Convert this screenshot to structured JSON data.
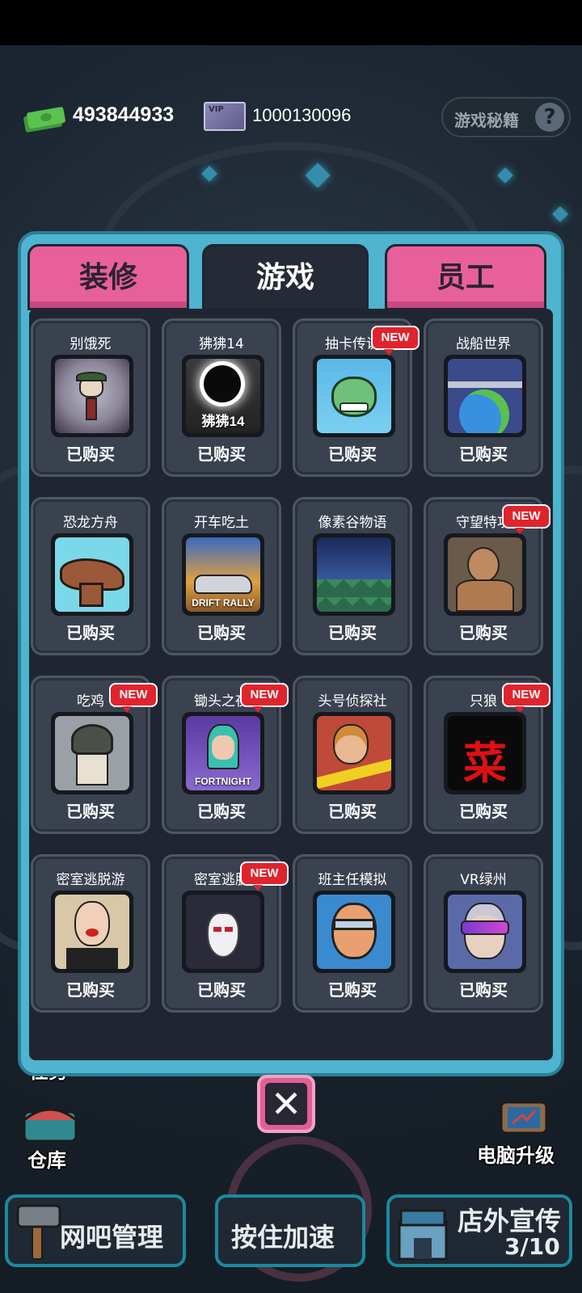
{
  "topbar": {
    "cash": "493844933",
    "vip_badge": "VIP",
    "vip_value": "1000130096",
    "secret_label": "游戏秘籍",
    "help_glyph": "?"
  },
  "tabs": [
    {
      "label": "装修"
    },
    {
      "label": "游戏"
    },
    {
      "label": "员工"
    }
  ],
  "partial_row_status": [
    "已购买",
    "已购买",
    "已购买",
    "已购买"
  ],
  "games": [
    {
      "name": "别饿死",
      "status": "已购买",
      "new": false,
      "icon": "dont-starve-icon"
    },
    {
      "name": "狒狒14",
      "status": "已购买",
      "new": false,
      "icon": "ff14-icon",
      "art_text": "狒狒14"
    },
    {
      "name": "抽卡传说",
      "status": "已购买",
      "new": true,
      "icon": "zombie-icon"
    },
    {
      "name": "战船世界",
      "status": "已购买",
      "new": false,
      "icon": "warship-icon"
    },
    {
      "name": "恐龙方舟",
      "status": "已购买",
      "new": false,
      "icon": "dinosaur-icon"
    },
    {
      "name": "开车吃土",
      "status": "已购买",
      "new": false,
      "icon": "rally-car-icon",
      "art_text": "DRIFT RALLY"
    },
    {
      "name": "像素谷物语",
      "status": "已购买",
      "new": false,
      "icon": "pixel-valley-icon"
    },
    {
      "name": "守望特攻",
      "status": "已购买",
      "new": true,
      "icon": "boxer-icon"
    },
    {
      "name": "吃鸡",
      "status": "已购买",
      "new": true,
      "icon": "pubg-icon"
    },
    {
      "name": "锄头之夜",
      "status": "已购买",
      "new": true,
      "icon": "fortnight-icon",
      "art_text": "FORTNIGHT"
    },
    {
      "name": "头号侦探社",
      "status": "已购买",
      "new": false,
      "icon": "detective-icon"
    },
    {
      "name": "只狼",
      "status": "已购买",
      "new": true,
      "icon": "vegetable-icon",
      "art_text": "菜"
    },
    {
      "name": "密室逃脱游",
      "status": "已购买",
      "new": false,
      "icon": "escape-room-icon"
    },
    {
      "name": "密室逃脱",
      "status": "已购买",
      "new": true,
      "icon": "mask-icon"
    },
    {
      "name": "班主任模拟",
      "status": "已购买",
      "new": false,
      "icon": "teacher-icon"
    },
    {
      "name": "VR绿州",
      "status": "已购买",
      "new": false,
      "icon": "vr-headset-icon"
    }
  ],
  "new_badge": "NEW",
  "close_glyph": "✕",
  "side": {
    "task": "任务",
    "warehouse": "仓库",
    "pc_upgrade": "电脑升级"
  },
  "bottom": {
    "manage": "网吧管理",
    "speed": "按住加速",
    "promo": "店外宣传",
    "promo_count": "3/10"
  }
}
